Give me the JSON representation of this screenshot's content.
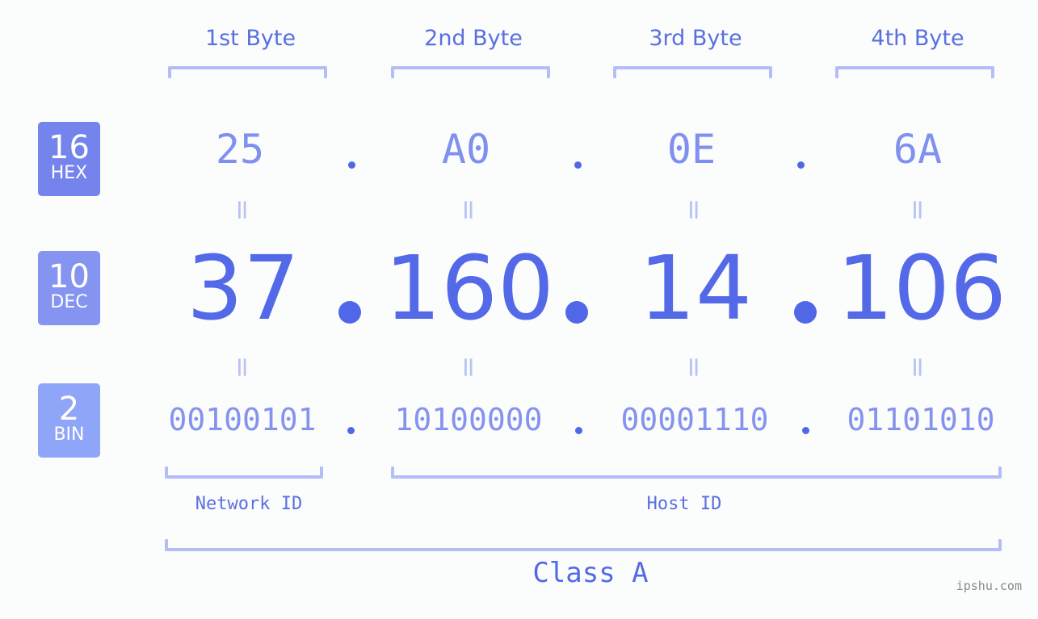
{
  "byte_headers": [
    "1st Byte",
    "2nd Byte",
    "3rd Byte",
    "4th Byte"
  ],
  "bases": [
    {
      "num": "16",
      "label": "HEX",
      "color": "#7584ec"
    },
    {
      "num": "10",
      "label": "DEC",
      "color": "#8594f0"
    },
    {
      "num": "2",
      "label": "BIN",
      "color": "#8fa5f7"
    }
  ],
  "hex": [
    "25",
    "A0",
    "0E",
    "6A"
  ],
  "dec": [
    "37",
    "160",
    "14",
    "106"
  ],
  "bin": [
    "00100101",
    "10100000",
    "00001110",
    "01101010"
  ],
  "equals": "=",
  "network_id_label": "Network ID",
  "host_id_label": "Host ID",
  "class_label": "Class A",
  "watermark": "ipshu.com"
}
